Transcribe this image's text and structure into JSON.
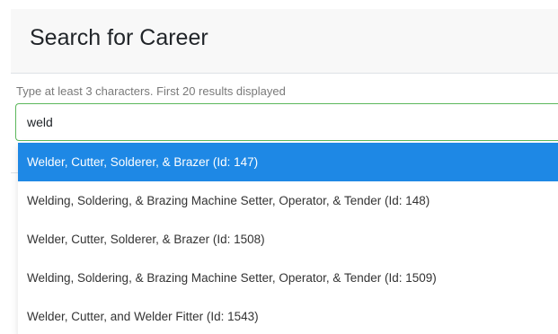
{
  "modal": {
    "title": "Search for Career"
  },
  "search": {
    "hint": "Type at least 3 characters. First 20 results displayed",
    "value": "weld",
    "placeholder": ""
  },
  "colors": {
    "highlight": "#1e88e5",
    "input_border": "#5cb85c",
    "header_bg": "#f8f8f8"
  },
  "results": [
    {
      "label": "Welder, Cutter, Solderer, & Brazer (Id: 147)",
      "active": true
    },
    {
      "label": "Welding, Soldering, & Brazing Machine Setter, Operator, & Tender (Id: 148)",
      "active": false
    },
    {
      "label": "Welder, Cutter, Solderer, & Brazer (Id: 1508)",
      "active": false
    },
    {
      "label": "Welding, Soldering, & Brazing Machine Setter, Operator, & Tender (Id: 1509)",
      "active": false
    },
    {
      "label": "Welder, Cutter, and Welder Fitter (Id: 1543)",
      "active": false
    }
  ]
}
